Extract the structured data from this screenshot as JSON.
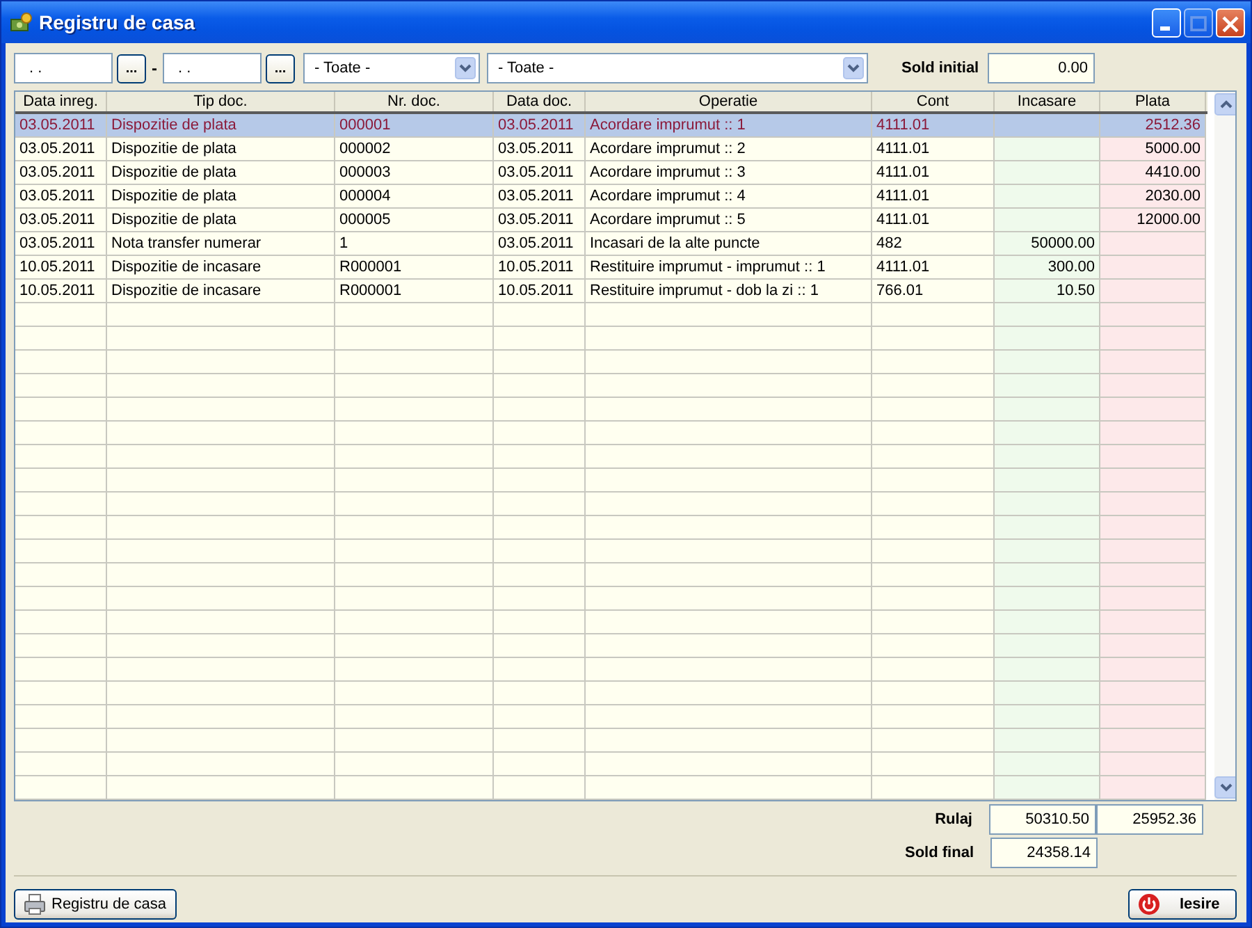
{
  "window": {
    "title": "Registru de casa"
  },
  "filters": {
    "date_from": ". .",
    "date_to": ". .",
    "browse_button": "...",
    "separator": "-",
    "dropdown_1": "- Toate -",
    "dropdown_2": "- Toate -",
    "sold_initial_label": "Sold initial",
    "sold_initial": "0.00"
  },
  "table": {
    "columns": [
      "Data inreg.",
      "Tip doc.",
      "Nr. doc.",
      "Data doc.",
      "Operatie",
      "Cont",
      "Incasare",
      "Plata"
    ],
    "rows": [
      {
        "selected": true,
        "cells": [
          "03.05.2011",
          "Dispozitie de plata",
          "000001",
          "03.05.2011",
          "Acordare imprumut :: 1",
          "4111.01",
          "",
          "2512.36"
        ]
      },
      {
        "selected": false,
        "cells": [
          "03.05.2011",
          "Dispozitie de plata",
          "000002",
          "03.05.2011",
          "Acordare imprumut :: 2",
          "4111.01",
          "",
          "5000.00"
        ]
      },
      {
        "selected": false,
        "cells": [
          "03.05.2011",
          "Dispozitie de plata",
          "000003",
          "03.05.2011",
          "Acordare imprumut :: 3",
          "4111.01",
          "",
          "4410.00"
        ]
      },
      {
        "selected": false,
        "cells": [
          "03.05.2011",
          "Dispozitie de plata",
          "000004",
          "03.05.2011",
          "Acordare imprumut :: 4",
          "4111.01",
          "",
          "2030.00"
        ]
      },
      {
        "selected": false,
        "cells": [
          "03.05.2011",
          "Dispozitie de plata",
          "000005",
          "03.05.2011",
          "Acordare imprumut :: 5",
          "4111.01",
          "",
          "12000.00"
        ]
      },
      {
        "selected": false,
        "cells": [
          "03.05.2011",
          "Nota transfer numerar",
          "1",
          "03.05.2011",
          "Incasari de la alte puncte",
          "482",
          "50000.00",
          ""
        ]
      },
      {
        "selected": false,
        "cells": [
          "10.05.2011",
          "Dispozitie de incasare",
          "R000001",
          "10.05.2011",
          "Restituire imprumut - imprumut :: 1",
          "4111.01",
          "300.00",
          ""
        ]
      },
      {
        "selected": false,
        "cells": [
          "10.05.2011",
          "Dispozitie de incasare",
          "R000001",
          "10.05.2011",
          "Restituire imprumut - dob la zi :: 1",
          "766.01",
          "10.50",
          ""
        ]
      }
    ]
  },
  "totals": {
    "rulaj_label": "Rulaj",
    "rulaj_incasare": "50310.50",
    "rulaj_plata": "25952.36",
    "sold_final_label": "Sold final",
    "sold_final": "24358.14"
  },
  "buttons": {
    "report": "Registru de casa",
    "exit": "Iesire"
  }
}
